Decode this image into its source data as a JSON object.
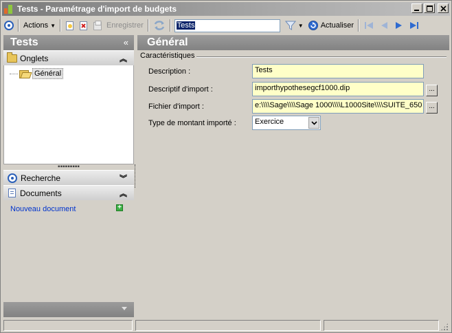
{
  "window": {
    "title": "Tests -  Paramétrage d'import de budgets"
  },
  "toolbar": {
    "actions_label": "Actions",
    "save_label": "Enregistrer",
    "search_value": "Tests",
    "refresh_label": "Actualiser"
  },
  "left": {
    "header": "Tests",
    "collapse_glyph": "«",
    "tabs_section": "Onglets",
    "tree_item": "Général",
    "search_section": "Recherche",
    "documents_section": "Documents",
    "new_document": "Nouveau document"
  },
  "right": {
    "header": "Général",
    "group": "Caractéristiques",
    "fields": {
      "description_label": "Description :",
      "description_value": "Tests",
      "descriptif_label": "Descriptif d'import :",
      "descriptif_value": "importhypothesegcf1000.dip",
      "fichier_label": "Fichier d'import :",
      "fichier_value": "e:\\\\\\\\Sage\\\\\\\\Sage 1000\\\\\\\\L1000Site\\\\\\\\SUITE_650",
      "type_label": "Type de montant importé :",
      "type_value": "Exercice"
    },
    "browse_glyph": "..."
  },
  "colors": {
    "header_gray": "#8c8c8c",
    "field_yellow": "#ffffc8",
    "link_blue": "#0033cc",
    "nav_blue": "#2a5fb8"
  }
}
